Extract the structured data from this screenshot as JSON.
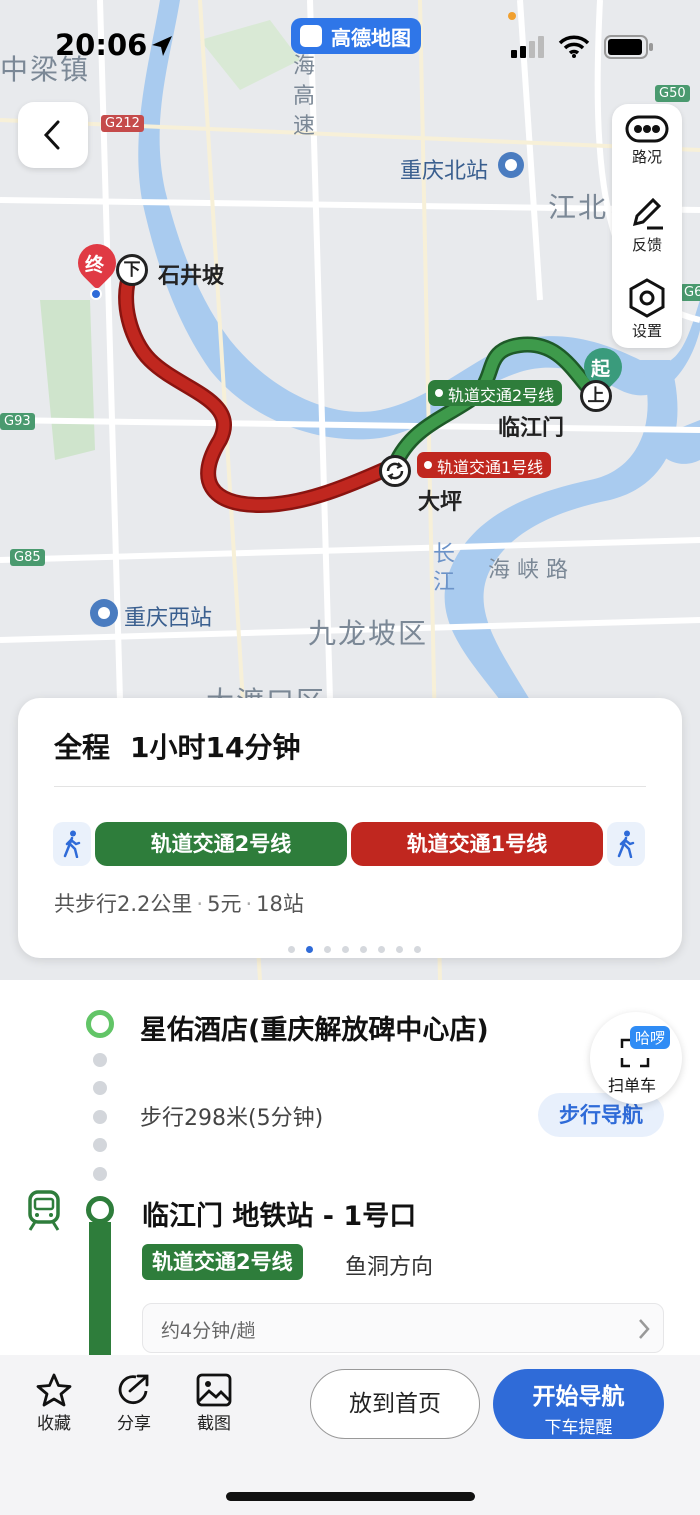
{
  "status_bar": {
    "time": "20:06",
    "app_name": "高德地图"
  },
  "map": {
    "labels": {
      "liangzhen": "中梁镇",
      "chongqing_north": "重庆北站",
      "jiangbei": "江北",
      "shijingpo": "石井坡",
      "linjiangmen": "临江门",
      "daping": "大坪",
      "chongqing_west": "重庆西站",
      "jiulongpo": "九龙坡区",
      "dadukou": "大渡口区",
      "haixia_road": "海 峡 路",
      "hai": "海",
      "gao": "高",
      "su": "速",
      "chang": "长",
      "jiang": "江"
    },
    "shields": {
      "g212": "G212",
      "g50": "G50",
      "g93": "G93",
      "g85": "G85",
      "g6": "G6"
    },
    "markers": {
      "end": "终",
      "start": "起",
      "alight": "下",
      "board": "上"
    },
    "line_tags": {
      "line2": "轨道交通2号线",
      "line1": "轨道交通1号线"
    },
    "colors": {
      "line2": "#2e7d3b",
      "line1": "#c0271f",
      "accent": "#2f6bd8"
    }
  },
  "right_panel": {
    "traffic": "路况",
    "feedback": "反馈",
    "settings": "设置"
  },
  "summary": {
    "total_label": "全程",
    "total_value": "1小时14分钟",
    "segments": [
      "轨道交通2号线",
      "轨道交通1号线"
    ],
    "walk_distance": "共步行2.2公里",
    "fare": "5元",
    "stops": "18站",
    "page_count": 8,
    "active_page": 2
  },
  "detail": {
    "start_name": "星佑酒店(重庆解放碑中心店)",
    "walk_info": "步行298米(5分钟)",
    "walk_nav_button": "步行导航",
    "scan_bike_badge": "哈啰",
    "scan_bike_label": "扫单车",
    "station_name": "临江门 地铁站 - 1号口",
    "line_chip": "轨道交通2号线",
    "direction": "鱼洞方向",
    "frequency": "约4分钟/趟"
  },
  "bottom_bar": {
    "favorite": "收藏",
    "share": "分享",
    "screenshot": "截图",
    "home_button": "放到首页",
    "nav_main": "开始导航",
    "nav_sub": "下车提醒"
  }
}
